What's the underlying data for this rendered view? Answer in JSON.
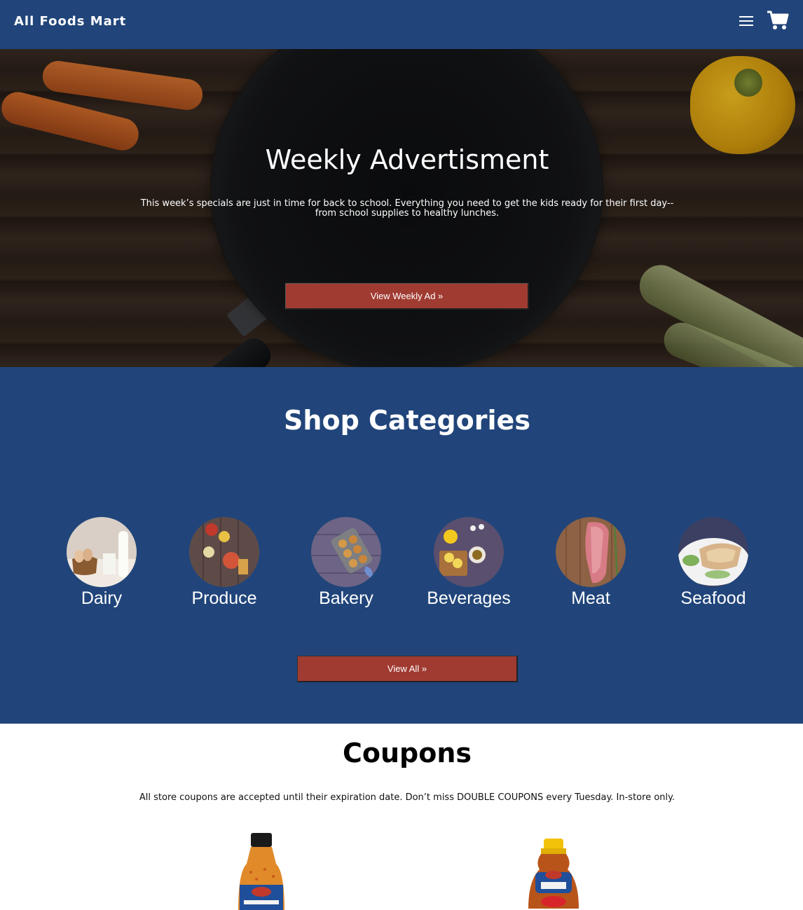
{
  "nav": {
    "brand": "All Foods Mart",
    "menu_icon": "hamburger-menu-icon",
    "cart_icon": "shopping-cart-icon"
  },
  "hero": {
    "title": "Weekly Advertisment",
    "text": "This week’s specials are just in time for back to school. Everything you need to get the kids ready for their first day-- from school supplies to healthy lunches.",
    "button_label": "View Weekly Ad »"
  },
  "categories": {
    "title": "Shop Categories",
    "items": [
      {
        "label": "Dairy"
      },
      {
        "label": "Produce"
      },
      {
        "label": "Bakery"
      },
      {
        "label": "Beverages"
      },
      {
        "label": "Meat"
      },
      {
        "label": "Seafood"
      }
    ],
    "button_label": "View All »"
  },
  "coupons": {
    "title": "Coupons",
    "text": "All store coupons are accepted until their expiration date. Don’t miss DOUBLE COUPONS every Tuesday. In-store only."
  },
  "colors": {
    "nav_bg": "#21457a",
    "button_bg": "#a03b32",
    "section_bg": "#21457a"
  }
}
